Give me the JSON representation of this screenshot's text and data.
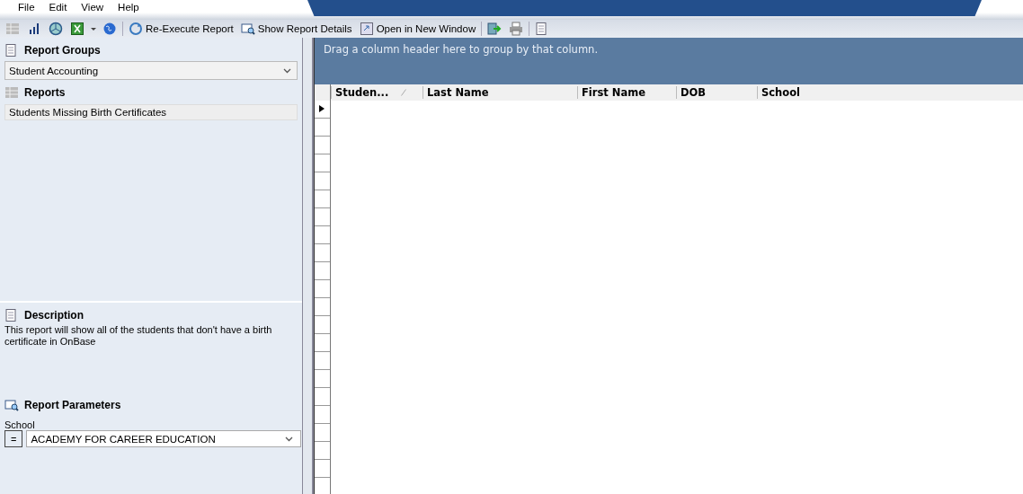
{
  "menu": [
    "File",
    "Edit",
    "View",
    "Help"
  ],
  "toolbar": [
    {
      "kind": "icon"
    },
    {
      "kind": "icon"
    },
    {
      "kind": "icon"
    },
    {
      "kind": "icon"
    },
    {
      "kind": "dropdown"
    },
    {
      "kind": "icon"
    },
    {
      "kind": "sep"
    },
    {
      "kind": "button",
      "label": "Re-Execute Report"
    },
    {
      "kind": "button",
      "label": "Show Report Details"
    },
    {
      "kind": "button",
      "label": "Open in New Window"
    },
    {
      "kind": "sep"
    },
    {
      "kind": "icon"
    },
    {
      "kind": "icon"
    },
    {
      "kind": "sep"
    },
    {
      "kind": "icon"
    }
  ],
  "report_groups": {
    "title": "Report Groups",
    "value": "Student Accounting"
  },
  "reports": {
    "title": "Reports",
    "items": [
      {
        "label": "Students Missing Birth Certificates",
        "selected": true
      }
    ]
  },
  "description": {
    "title": "Description",
    "text": "This report will show all of the students that don't have a birth certificate in OnBase"
  },
  "parameters": {
    "title": "Report Parameters",
    "items": [
      {
        "label": "School",
        "operator": "=",
        "value": "ACADEMY FOR CAREER EDUCATION"
      }
    ]
  },
  "grid": {
    "group_hint": "Drag a column header here to group by that column.",
    "columns": [
      {
        "label": "Studen...",
        "sorted": true
      },
      {
        "label": "Last Name",
        "sorted": false
      },
      {
        "label": "First Name",
        "sorted": false
      },
      {
        "label": "DOB",
        "sorted": false
      },
      {
        "label": "School",
        "sorted": false
      }
    ]
  }
}
